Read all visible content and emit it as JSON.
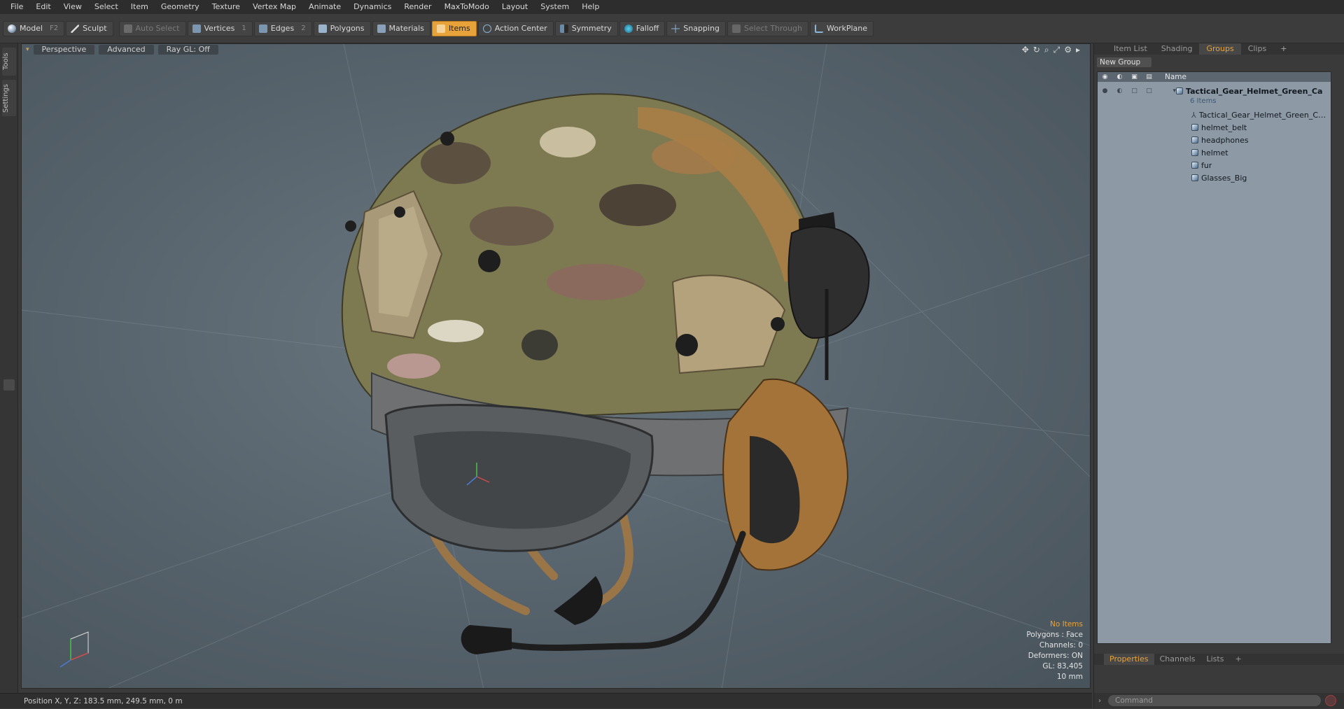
{
  "menu": [
    "File",
    "Edit",
    "View",
    "Select",
    "Item",
    "Geometry",
    "Texture",
    "Vertex Map",
    "Animate",
    "Dynamics",
    "Render",
    "MaxToModo",
    "Layout",
    "System",
    "Help"
  ],
  "toolbar": {
    "model": "Model",
    "model_key": "F2",
    "sculpt": "Sculpt",
    "auto_select": "Auto Select",
    "vertices": "Vertices",
    "vertices_key": "1",
    "edges": "Edges",
    "edges_key": "2",
    "polygons": "Polygons",
    "materials": "Materials",
    "items": "Items",
    "action_center": "Action Center",
    "symmetry": "Symmetry",
    "falloff": "Falloff",
    "snapping": "Snapping",
    "select_through": "Select Through",
    "workplane": "WorkPlane",
    "accent": "#e8a23a"
  },
  "left_strip": {
    "tools": "Tools",
    "settings": "Settings"
  },
  "viewport": {
    "perspective": "Perspective",
    "advanced": "Advanced",
    "raygl": "Ray GL: Off",
    "info": {
      "selection": "No Items",
      "polygons": "Polygons : Face",
      "channels": "Channels: 0",
      "deformers": "Deformers: ON",
      "gl": "GL: 83,405",
      "scale": "10 mm"
    }
  },
  "status": {
    "position": "Position X, Y, Z:  183.5 mm, 249.5 mm, 0 m"
  },
  "right_panel": {
    "tabs": [
      "Item List",
      "Shading",
      "Groups",
      "Clips",
      "+"
    ],
    "active_tab": "Groups",
    "new_group": "New Group",
    "column_name": "Name",
    "root": "Tactical_Gear_Helmet_Green_Ca",
    "root_count": "6 Items",
    "items": [
      "Tactical_Gear_Helmet_Green_Camo_",
      "helmet_belt",
      "headphones",
      "helmet",
      "fur",
      "Glasses_Big"
    ],
    "bottom_tabs": [
      "Properties",
      "Channels",
      "Lists",
      "+"
    ],
    "command_placeholder": "Command"
  }
}
